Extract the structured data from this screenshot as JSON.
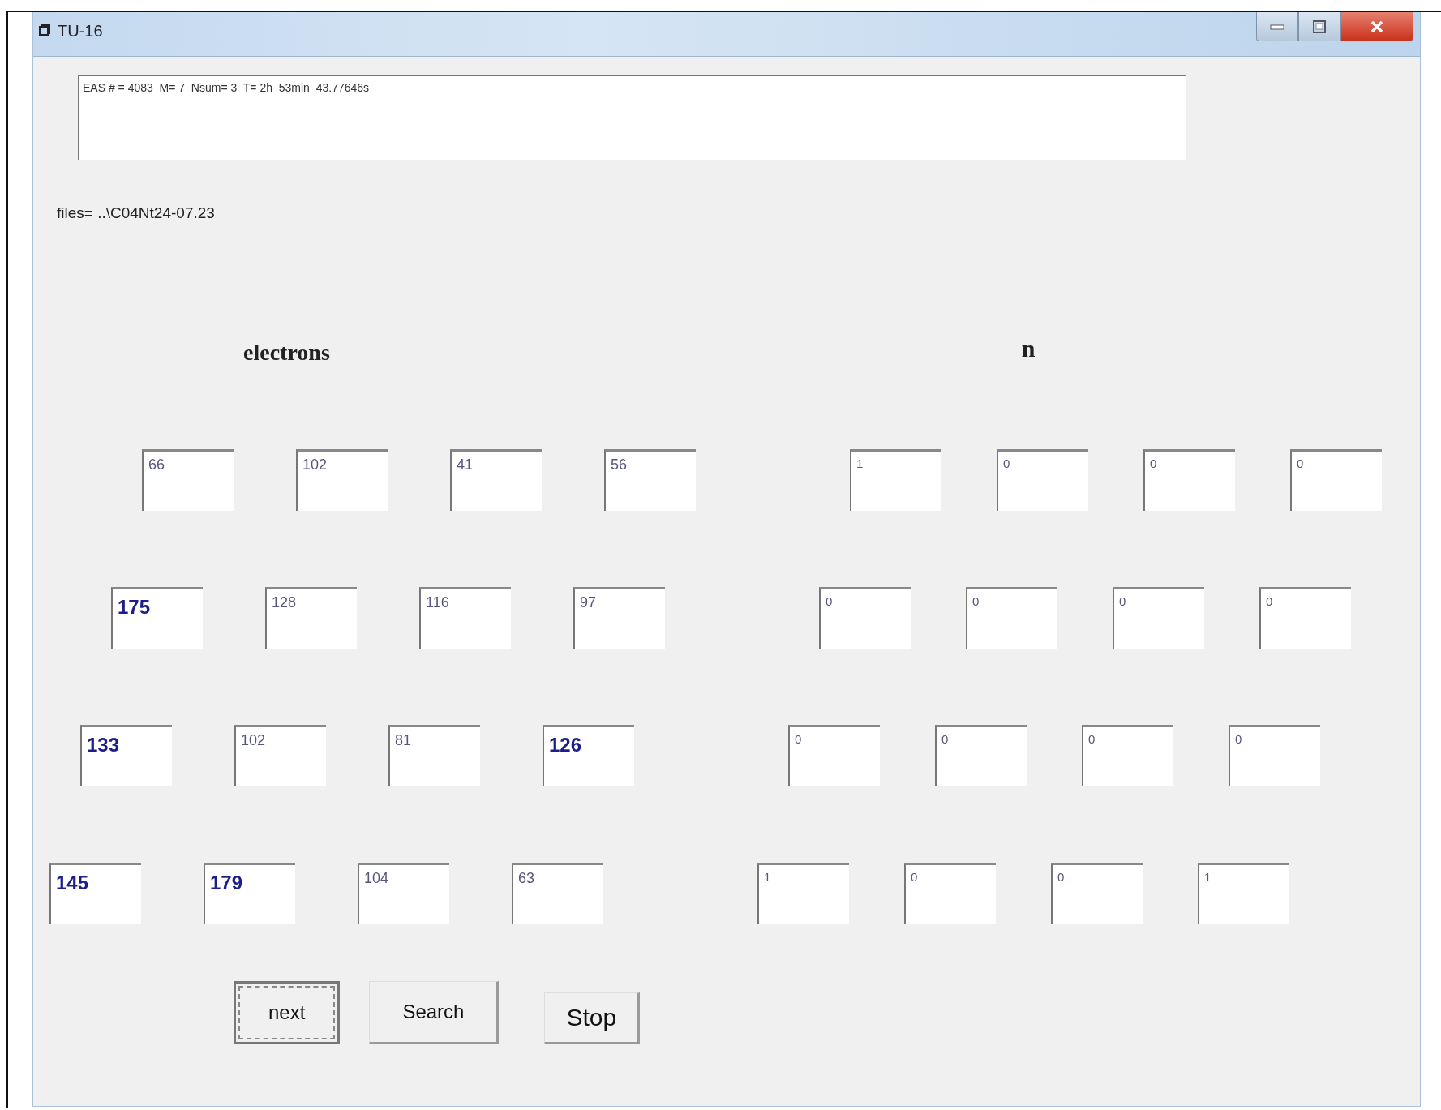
{
  "window": {
    "title": "TU-16"
  },
  "output_box": {
    "value": "EAS # = 4083  M= 7  Nsum= 3  T= 2h  53min  43.77646s"
  },
  "files_label": "files= ..\\C04Nt24-07.23",
  "electrons": {
    "heading": "electrons",
    "rows": [
      [
        {
          "value": "66",
          "highlighted": false
        },
        {
          "value": "102",
          "highlighted": false
        },
        {
          "value": "41",
          "highlighted": false
        },
        {
          "value": "56",
          "highlighted": false
        }
      ],
      [
        {
          "value": "175",
          "highlighted": true
        },
        {
          "value": "128",
          "highlighted": false
        },
        {
          "value": "116",
          "highlighted": false
        },
        {
          "value": "97",
          "highlighted": false
        }
      ],
      [
        {
          "value": "133",
          "highlighted": true
        },
        {
          "value": "102",
          "highlighted": false
        },
        {
          "value": "81",
          "highlighted": false
        },
        {
          "value": "126",
          "highlighted": true
        }
      ],
      [
        {
          "value": "145",
          "highlighted": true
        },
        {
          "value": "179",
          "highlighted": true
        },
        {
          "value": "104",
          "highlighted": false
        },
        {
          "value": "63",
          "highlighted": false
        }
      ]
    ]
  },
  "n": {
    "heading": "n",
    "rows": [
      [
        {
          "value": "1",
          "highlighted": false
        },
        {
          "value": "0",
          "highlighted": false
        },
        {
          "value": "0",
          "highlighted": false
        },
        {
          "value": "0",
          "highlighted": false
        }
      ],
      [
        {
          "value": "0",
          "highlighted": false
        },
        {
          "value": "0",
          "highlighted": false
        },
        {
          "value": "0",
          "highlighted": false
        },
        {
          "value": "0",
          "highlighted": false
        }
      ],
      [
        {
          "value": "0",
          "highlighted": false
        },
        {
          "value": "0",
          "highlighted": false
        },
        {
          "value": "0",
          "highlighted": false
        },
        {
          "value": "0",
          "highlighted": false
        }
      ],
      [
        {
          "value": "1",
          "highlighted": false
        },
        {
          "value": "0",
          "highlighted": false
        },
        {
          "value": "0",
          "highlighted": false
        },
        {
          "value": "1",
          "highlighted": false
        }
      ]
    ]
  },
  "buttons": [
    {
      "label": "next",
      "focused": true
    },
    {
      "label": "Search",
      "focused": false
    },
    {
      "label": "Stop",
      "focused": false
    }
  ]
}
